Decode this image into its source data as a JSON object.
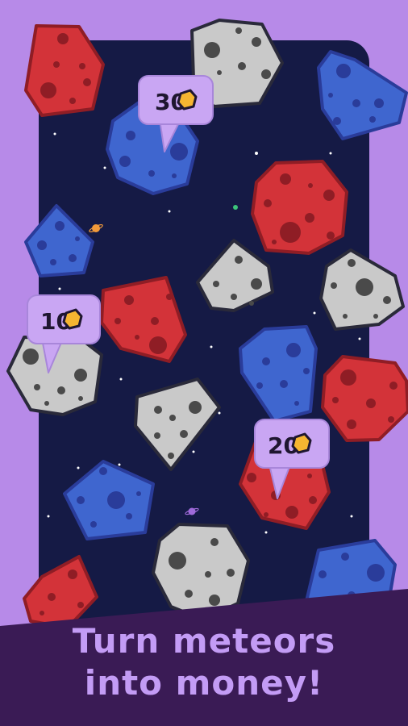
{
  "colors": {
    "background": "#b78ae8",
    "space": "#151a45",
    "banner": "#3a1b55",
    "caption_text": "#c39cf5",
    "meteor_red": "#d33339",
    "meteor_red_dark": "#8f1d25",
    "meteor_blue": "#3f66cf",
    "meteor_blue_dark": "#2a3c9a",
    "meteor_gray": "#c9c9c9",
    "meteor_gray_dark": "#4a4a4a",
    "outline": "#1b1b2e",
    "badge": "#c9a6f3",
    "badge_text": "#1f1630",
    "coin": "#f6b531"
  },
  "price_badges": [
    {
      "value": "30",
      "icon": "coin-icon"
    },
    {
      "value": "10",
      "icon": "coin-icon"
    },
    {
      "value": "20",
      "icon": "coin-icon"
    }
  ],
  "meteors": [
    {
      "color": "red"
    },
    {
      "color": "gray"
    },
    {
      "color": "blue"
    },
    {
      "color": "blue"
    },
    {
      "color": "red"
    },
    {
      "color": "blue"
    },
    {
      "color": "gray"
    },
    {
      "color": "gray"
    },
    {
      "color": "red"
    },
    {
      "color": "gray"
    },
    {
      "color": "blue"
    },
    {
      "color": "red"
    },
    {
      "color": "gray"
    },
    {
      "color": "red"
    },
    {
      "color": "blue"
    },
    {
      "color": "gray"
    },
    {
      "color": "red"
    },
    {
      "color": "blue"
    }
  ],
  "caption": {
    "line1": "Turn meteors",
    "line2": "into money!"
  }
}
